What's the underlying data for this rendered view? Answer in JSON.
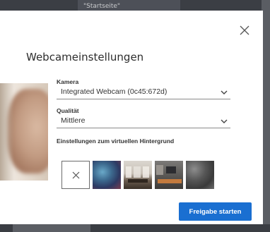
{
  "background": {
    "top_text": "\"Startseite\""
  },
  "dialog": {
    "title": "Webcameinstellungen",
    "close_icon": "close-icon",
    "camera": {
      "label": "Kamera",
      "value": "Integrated Webcam (0c45:672d)"
    },
    "quality": {
      "label": "Qualität",
      "value": "Mittlere"
    },
    "virtual_background": {
      "label": "Einstellungen zum virtuellen Hintergrund",
      "options": [
        "none",
        "blur",
        "room-1",
        "room-2",
        "texture"
      ]
    },
    "share_button": "Freigabe starten"
  },
  "colors": {
    "accent": "#1a6fd1",
    "dialog_bg": "#ffffff",
    "page_bg": "#4a4d54"
  }
}
